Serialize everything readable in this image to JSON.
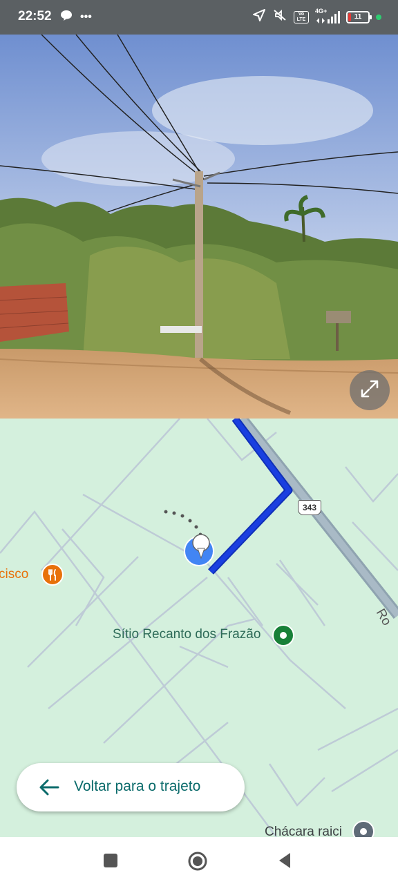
{
  "status_bar": {
    "time": "22:52",
    "more": "•••",
    "network_badge_top": "4G+",
    "volte_badge": "Vo LTE",
    "battery": "11",
    "icons": [
      "chat-bubble-icon",
      "location-arrow-icon",
      "mute-icon",
      "volte-icon",
      "signal-icon",
      "battery-icon"
    ]
  },
  "street_view": {
    "expand_icon": "expand-icon"
  },
  "map": {
    "route_shield": "343",
    "road_label": "Ro",
    "poi_left_label": "cisco",
    "poi_left_icon": "restaurant-icon",
    "poi_center_label": "Sítio Recanto dos Frazão",
    "poi_center_icon": "place-pin-icon",
    "poi_bottom_label": "Chácara raici",
    "poi_bottom_icon": "place-pin-icon",
    "colors": {
      "route": "#1a3fe0",
      "map_bg": "#d4f0dd",
      "highway": "#8fa3b0"
    }
  },
  "back_button": {
    "label": "Voltar para o trajeto",
    "icon": "arrow-left-icon"
  },
  "nav_bar": {
    "icons": [
      "recent-apps-icon",
      "home-icon",
      "back-icon"
    ]
  }
}
